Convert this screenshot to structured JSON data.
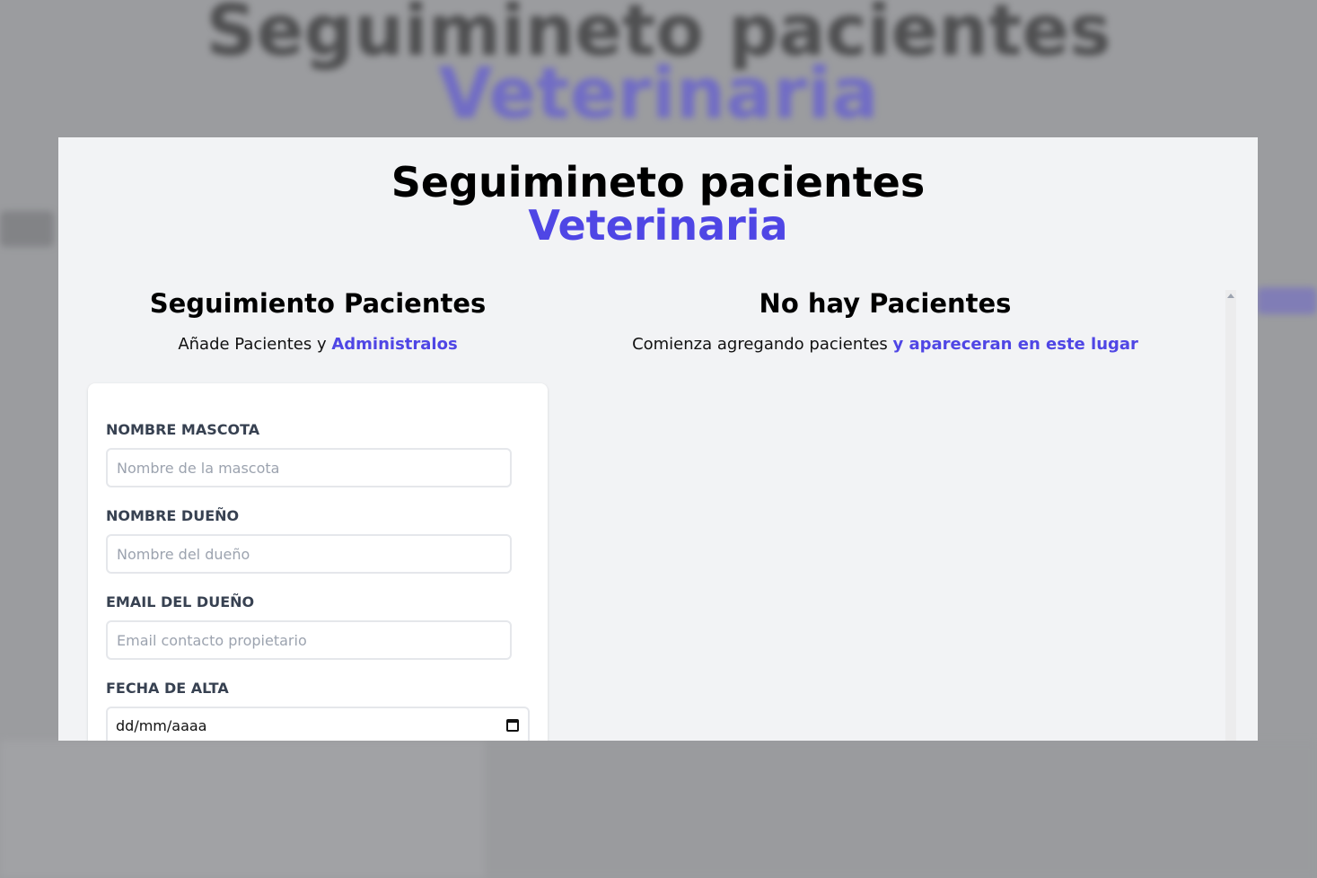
{
  "background": {
    "title": "Seguimineto pacientes",
    "title_accent": "Veterinaria"
  },
  "modal": {
    "title": "Seguimineto pacientes",
    "title_accent": "Veterinaria"
  },
  "form_section": {
    "heading": "Seguimiento Pacientes",
    "subtitle_prefix": "Añade Pacientes y ",
    "subtitle_accent": "Administralos",
    "fields": [
      {
        "label": "NOMBRE MASCOTA",
        "placeholder": "Nombre de la mascota",
        "value": ""
      },
      {
        "label": "NOMBRE DUEÑO",
        "placeholder": "Nombre del dueño",
        "value": ""
      },
      {
        "label": "EMAIL DEL DUEÑO",
        "placeholder": "Email contacto propietario",
        "value": ""
      },
      {
        "label": "FECHA DE ALTA",
        "value": "dd/mm/aaaa",
        "icon": "calendar-icon"
      }
    ]
  },
  "patients_section": {
    "heading": "No hay Pacientes",
    "subtitle_prefix": "Comienza agregando pacientes ",
    "subtitle_accent": "y apareceran en este lugar"
  },
  "colors": {
    "accent": "#4f46e5",
    "modal_bg": "#f2f3f5",
    "overlay": "#9b9c9f"
  }
}
